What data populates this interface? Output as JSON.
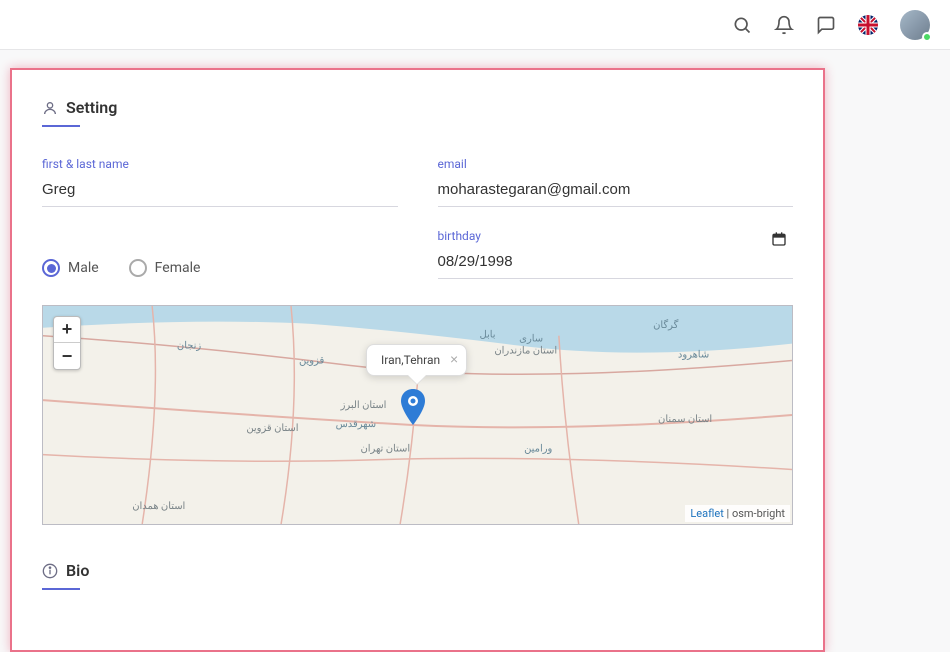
{
  "topbar": {
    "icons": [
      "search",
      "bell",
      "comment",
      "flag",
      "avatar"
    ]
  },
  "settings": {
    "title": "Setting",
    "name_label": "first & last name",
    "name_value": "Greg",
    "email_label": "email",
    "email_value": "moharastegaran@gmail.com",
    "birthday_label": "birthday",
    "birthday_value": "08/29/1998",
    "gender": {
      "male_label": "Male",
      "female_label": "Female",
      "selected": "male"
    }
  },
  "map": {
    "zoom_in": "+",
    "zoom_out": "−",
    "popup_text": "Iran,Tehran",
    "attribution_link": "Leaflet",
    "attribution_rest": " | osm-bright"
  },
  "bio": {
    "title": "Bio"
  }
}
